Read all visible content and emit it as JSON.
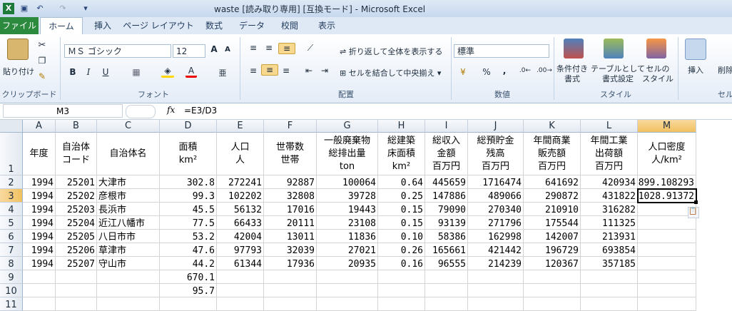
{
  "window": {
    "title": "waste [読み取り専用] [互換モード] - Microsoft Excel"
  },
  "ribbon": {
    "tabs": [
      "ファイル",
      "ホーム",
      "挿入",
      "ページ レイアウト",
      "数式",
      "データ",
      "校閲",
      "表示"
    ],
    "clipboard": {
      "paste": "貼り付け",
      "label": "クリップボード"
    },
    "font": {
      "name": "ＭＳ ゴシック",
      "size": "12",
      "label": "フォント"
    },
    "alignment": {
      "wrap": "折り返して全体を表示する",
      "merge": "セルを結合して中央揃え",
      "label": "配置"
    },
    "number": {
      "format": "標準",
      "percent": "%",
      "comma": ",",
      "label": "数値"
    },
    "styles": {
      "conditional": "条件付き\n書式",
      "table": "テーブルとして\n書式設定",
      "cell": "セルの\nスタイル",
      "label": "スタイル"
    },
    "cells": {
      "insert": "挿入",
      "delete": "削除",
      "label": "セル"
    }
  },
  "formula_bar": {
    "name_box": "M3",
    "fx": "fx",
    "formula": "=E3/D3"
  },
  "sheet": {
    "columns": [
      "A",
      "B",
      "C",
      "D",
      "E",
      "F",
      "G",
      "H",
      "I",
      "J",
      "K",
      "L",
      "M"
    ],
    "selected_column": "M",
    "selected_row": "3",
    "rows": [
      "1",
      "2",
      "3",
      "4",
      "5",
      "6",
      "7",
      "8",
      "9",
      "10",
      "11"
    ],
    "headers": [
      "年度",
      "自治体\nコード",
      "自治体名",
      "面積\nkm²",
      "人口\n人",
      "世帯数\n世帯",
      "一般廃棄物\n総排出量\nton",
      "総建築\n床面積\nkm²",
      "総収入\n金額\n百万円",
      "総預貯金\n残高\n百万円",
      "年間商業\n販売額\n百万円",
      "年間工業\n出荷額\n百万円",
      "人口密度\n人/km²"
    ],
    "data": [
      [
        "1994",
        "25201",
        "大津市",
        "302.8",
        "272241",
        "92887",
        "100064",
        "0.64",
        "445659",
        "1716474",
        "641692",
        "420934",
        "899.108293"
      ],
      [
        "1994",
        "25202",
        "彦根市",
        "99.3",
        "102202",
        "32808",
        "39728",
        "0.25",
        "147886",
        "489066",
        "290872",
        "431822",
        "1028.91372"
      ],
      [
        "1994",
        "25203",
        "長浜市",
        "45.5",
        "56132",
        "17016",
        "19443",
        "0.15",
        "79090",
        "270340",
        "210910",
        "316282",
        ""
      ],
      [
        "1994",
        "25204",
        "近江八幡市",
        "77.5",
        "66433",
        "20111",
        "23108",
        "0.15",
        "93139",
        "271796",
        "175544",
        "111325",
        ""
      ],
      [
        "1994",
        "25205",
        "八日市市",
        "53.2",
        "42004",
        "13011",
        "11836",
        "0.10",
        "58386",
        "162998",
        "142007",
        "213931",
        ""
      ],
      [
        "1994",
        "25206",
        "草津市",
        "47.6",
        "97793",
        "32039",
        "27021",
        "0.26",
        "165661",
        "421442",
        "196729",
        "693854",
        ""
      ],
      [
        "1994",
        "25207",
        "守山市",
        "44.2",
        "61344",
        "17936",
        "20935",
        "0.16",
        "96555",
        "214239",
        "120367",
        "357185",
        ""
      ],
      [
        "",
        "",
        "",
        "670.1",
        "",
        "",
        "",
        "",
        "",
        "",
        "",
        "",
        ""
      ],
      [
        "",
        "",
        "",
        "95.7",
        "",
        "",
        "",
        "",
        "",
        "",
        "",
        "",
        ""
      ],
      [
        "",
        "",
        "",
        "",
        "",
        "",
        "",
        "",
        "",
        "",
        "",
        "",
        ""
      ]
    ]
  }
}
